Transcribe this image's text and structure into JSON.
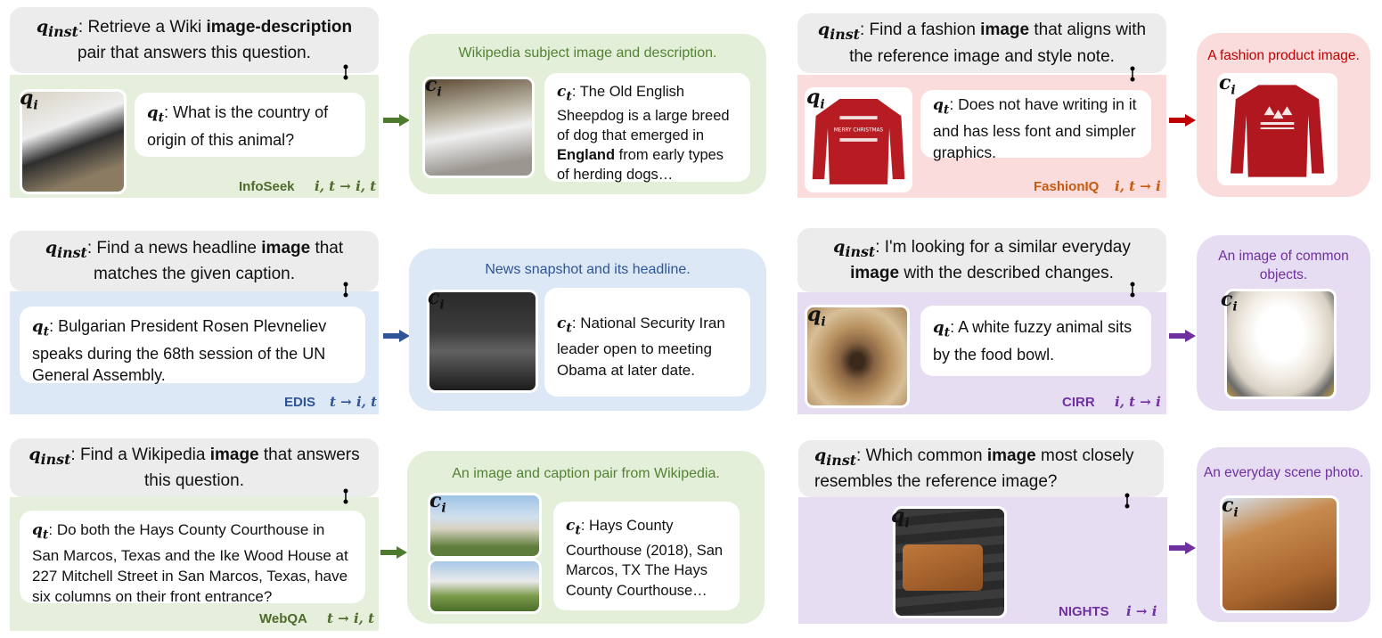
{
  "colors": {
    "green_band": "#e6efdb",
    "green_cand": "#e3efd8",
    "green_label": "#4e6a2d",
    "blue_band": "#dce8f5",
    "blue_label": "#2f5597",
    "pink_band": "#fbdcdc",
    "pink_label": "#c55a11",
    "pink_title": "#c00000",
    "purple_band": "#e6ddf2",
    "purple_label": "#7030a0",
    "arrow_green": "#4e7a2d",
    "arrow_blue": "#2f5597",
    "arrow_red": "#c00000",
    "arrow_purple": "#7030a0"
  },
  "panels": {
    "infoseek": {
      "inst_pre": "Retrieve a Wiki ",
      "inst_bold": "image-description",
      "inst_post": " pair that answers this question.",
      "qt": "What is the country of origin of this animal?",
      "dataset": "InfoSeek",
      "task": "i, t → i, t",
      "cand_title": "Wikipedia subject image and description.",
      "ct_pre": "The Old English Sheepdog is a large breed of dog that emerged in ",
      "ct_bold": "England",
      "ct_post": " from early types of herding dogs…"
    },
    "edis": {
      "inst_pre": "Find a news headline ",
      "inst_bold": "image",
      "inst_post": " that matches the given caption.",
      "qt": "Bulgarian President Rosen Plevneliev speaks during the 68th session of the UN General Assembly.",
      "dataset": "EDIS",
      "task": "t → i, t",
      "cand_title": "News snapshot and its headline.",
      "ct": "National Security Iran leader open to meeting Obama at later date."
    },
    "webqa": {
      "inst_pre": "Find a Wikipedia ",
      "inst_bold": "image",
      "inst_post": " that answers this question.",
      "qt": "Do both the Hays County Courthouse in San Marcos, Texas and the Ike Wood House at 227 Mitchell  Street in San Marcos, Texas, have six columns on their front entrance?",
      "dataset": "WebQA",
      "task": "t → i, t",
      "cand_title": "An image and caption pair from Wikipedia.",
      "ct": "Hays County Courthouse (2018), San Marcos, TX The Hays County Courthouse…"
    },
    "fashioniq": {
      "inst_pre": "Find a fashion ",
      "inst_bold": "image",
      "inst_post": " that aligns with the reference image and style note.",
      "qt": "Does not have writing in it and has less font and simpler graphics.",
      "dataset": "FashionIQ",
      "task": "i, t → i",
      "cand_title": "A fashion product image.",
      "sweater_text": "MERRY CHRISTMAS"
    },
    "cirr": {
      "inst_pre": "I'm looking for a similar everyday ",
      "inst_bold": "image",
      "inst_post": " with the described changes.",
      "qt": "A white fuzzy animal sits by the food bowl.",
      "dataset": "CIRR",
      "task": "i, t → i",
      "cand_title": "An image of common objects."
    },
    "nights": {
      "inst_pre": " Which common ",
      "inst_bold": "image",
      "inst_post": " most closely resembles the reference image?",
      "dataset": "NIGHTS",
      "task": "i → i",
      "cand_title": "An everyday scene photo."
    }
  }
}
